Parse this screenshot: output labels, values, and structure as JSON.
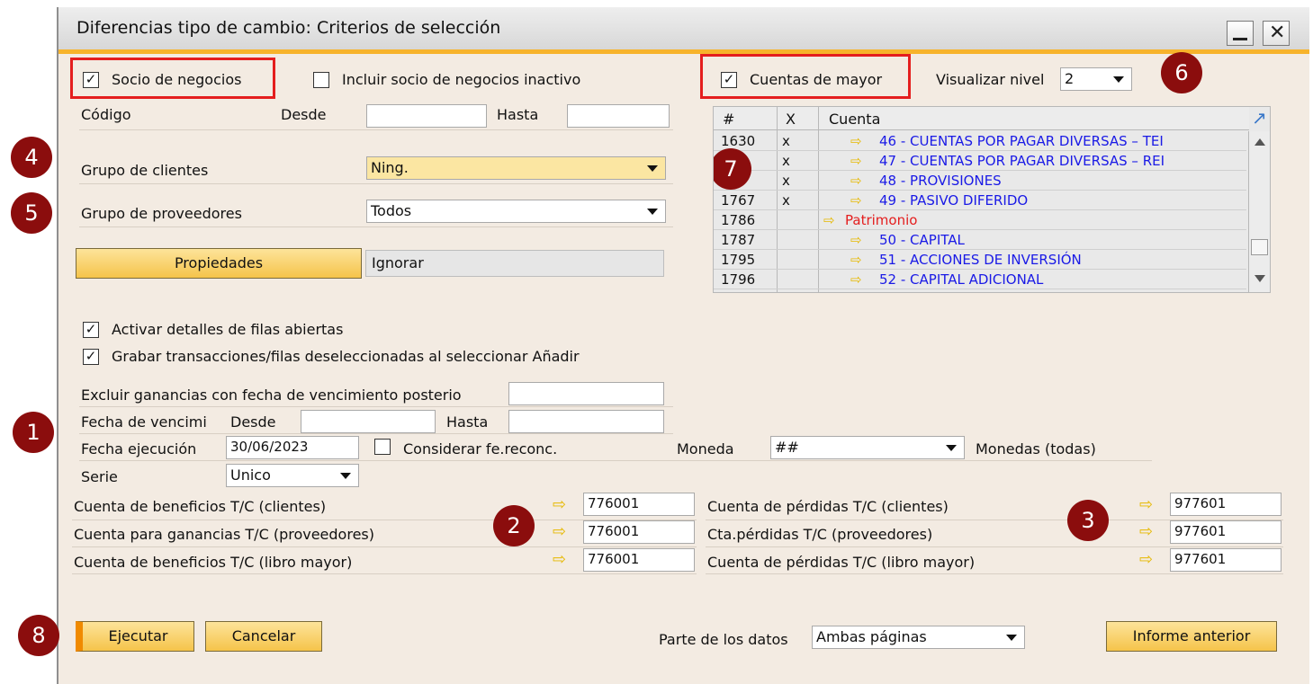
{
  "window": {
    "title": "Diferencias tipo de cambio: Criterios de selección"
  },
  "bp": {
    "socio_label": "Socio de negocios",
    "inactive_label": "Incluir socio de negocios inactivo",
    "codigo_label": "Código",
    "desde_label": "Desde",
    "hasta_label": "Hasta",
    "desde_value": "",
    "hasta_value": "",
    "grupo_clientes_label": "Grupo de clientes",
    "grupo_clientes_value": "Ning.",
    "grupo_proveedores_label": "Grupo de proveedores",
    "grupo_proveedores_value": "Todos",
    "propiedades_label": "Propiedades",
    "ignorar_label": "Ignorar"
  },
  "gl": {
    "cuentas_label": "Cuentas de mayor",
    "nivel_label": "Visualizar nivel",
    "nivel_value": "2",
    "grid": {
      "headers": [
        "#",
        "X",
        "Cuenta"
      ],
      "rows": [
        {
          "num": "1630",
          "x": "x",
          "cuenta": "46 - CUENTAS POR PAGAR DIVERSAS – TEI",
          "level": 2
        },
        {
          "num": "",
          "x": "x",
          "cuenta": "47 - CUENTAS POR PAGAR DIVERSAS – REI",
          "level": 2
        },
        {
          "num": "",
          "x": "x",
          "cuenta": "48 - PROVISIONES",
          "level": 2
        },
        {
          "num": "1767",
          "x": "x",
          "cuenta": "49 - PASIVO DIFERIDO",
          "level": 2
        },
        {
          "num": "1786",
          "x": "",
          "cuenta": "Patrimonio",
          "level": 1
        },
        {
          "num": "1787",
          "x": "",
          "cuenta": "50 - CAPITAL",
          "level": 2
        },
        {
          "num": "1795",
          "x": "",
          "cuenta": "51 - ACCIONES DE INVERSIÓN",
          "level": 2
        },
        {
          "num": "1796",
          "x": "",
          "cuenta": "52 - CAPITAL ADICIONAL",
          "level": 2
        }
      ]
    }
  },
  "options": {
    "activar_label": "Activar detalles de filas abiertas",
    "grabar_label": "Grabar transacciones/filas deseleccionadas al seleccionar Añadir",
    "excluir_label": "Excluir ganancias con fecha de vencimiento posterio",
    "excluir_value": "",
    "fecha_venc_label": "Fecha de vencimi",
    "desde_label": "Desde",
    "hasta_label": "Hasta",
    "fecha_ejec_label": "Fecha ejecución",
    "fecha_ejec_value": "30/06/2023",
    "considerar_label": "Considerar fe.reconc.",
    "moneda_label": "Moneda",
    "moneda_value": "##",
    "monedas_label": "Monedas (todas)",
    "serie_label": "Serie",
    "serie_value": "Unico"
  },
  "accounts": {
    "left": [
      {
        "label": "Cuenta de beneficios T/C (clientes)",
        "value": "776001"
      },
      {
        "label": "Cuenta para ganancias T/C (proveedores)",
        "value": "776001"
      },
      {
        "label": "Cuenta de beneficios T/C (libro mayor)",
        "value": "776001"
      }
    ],
    "right": [
      {
        "label": "Cuenta de pérdidas T/C (clientes)",
        "value": "977601"
      },
      {
        "label": "Cta.pérdidas T/C (proveedores)",
        "value": "977601"
      },
      {
        "label": "Cuenta de pérdidas T/C (libro mayor)",
        "value": "977601"
      }
    ]
  },
  "footer": {
    "ejecutar_label": "Ejecutar",
    "cancelar_label": "Cancelar",
    "parte_label": "Parte de los datos",
    "parte_value": "Ambas páginas",
    "informe_label": "Informe anterior"
  },
  "markers": [
    "1",
    "2",
    "3",
    "4",
    "5",
    "6",
    "7",
    "8"
  ],
  "colors": {
    "accent": "#f7b32b",
    "marker": "#8b0d0d",
    "highlight": "#e41e1e",
    "link": "#1a1ae6",
    "equity": "#e41e1e"
  }
}
